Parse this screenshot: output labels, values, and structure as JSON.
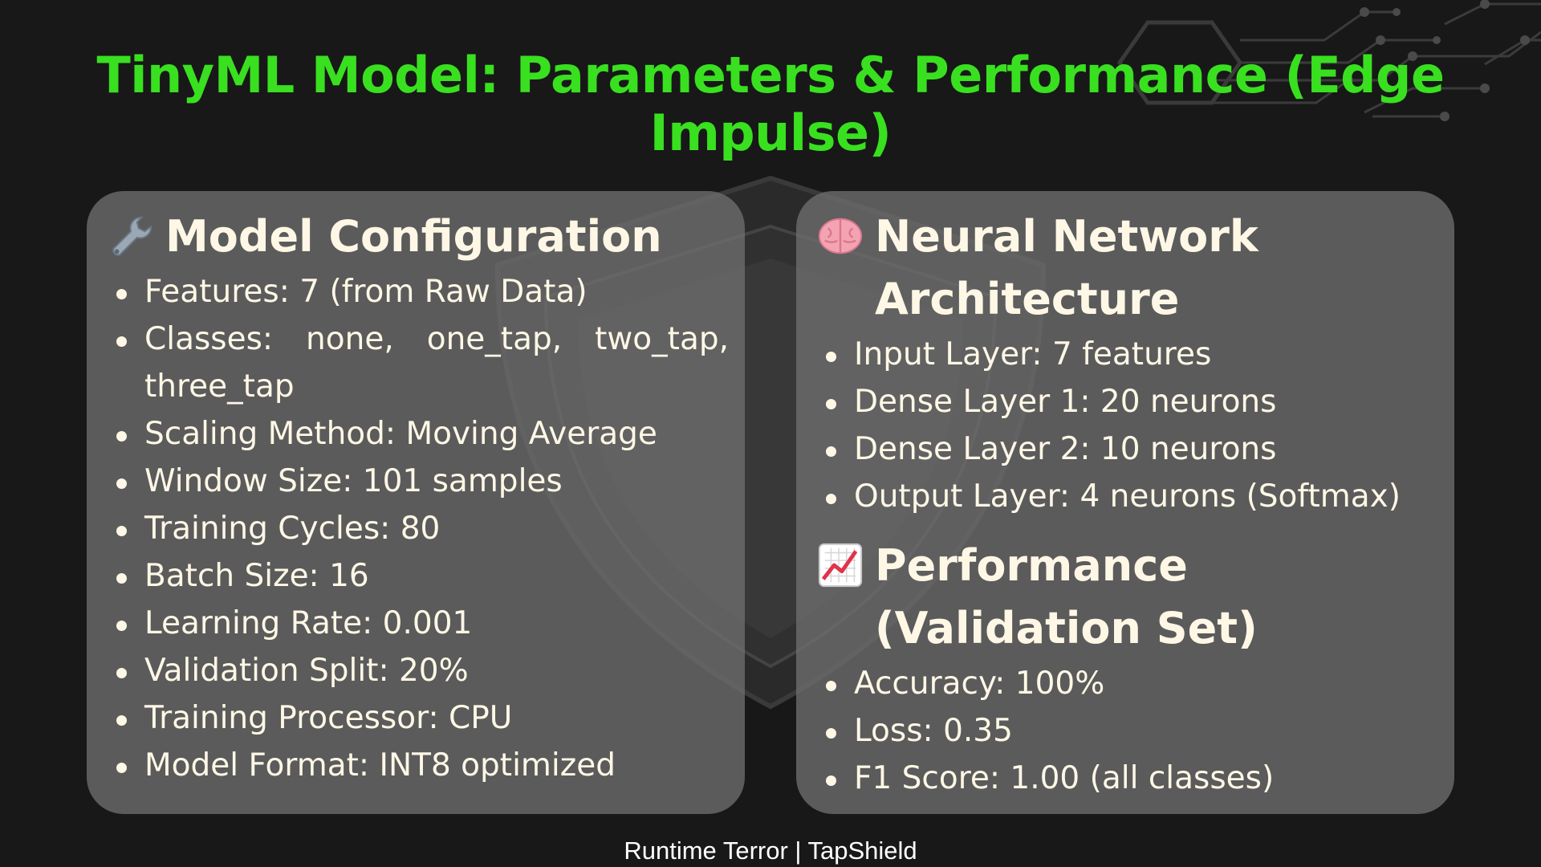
{
  "title": "TinyML Model: Parameters & Performance (Edge Impulse)",
  "model_config": {
    "heading": "Model Configuration",
    "icon": "wrench-icon",
    "items": [
      "Features: 7 (from Raw Data)",
      "Classes: none, one_tap, two_tap, three_tap",
      "Scaling Method: Moving Average",
      "Window Size: 101 samples",
      "Training Cycles: 80",
      "Batch Size: 16",
      "Learning Rate: 0.001",
      "Validation Split: 20%",
      "Training Processor: CPU",
      "Model Format: INT8 optimized"
    ]
  },
  "architecture": {
    "heading": "Neural Network Architecture",
    "icon": "brain-icon",
    "items": [
      "Input Layer: 7 features",
      "Dense Layer 1: 20 neurons",
      "Dense Layer 2: 10 neurons",
      "Output Layer: 4 neurons (Softmax)"
    ]
  },
  "performance": {
    "heading": "Performance (Validation Set)",
    "icon": "chart-increasing-icon",
    "items": [
      "Accuracy: 100%",
      "Loss: 0.35",
      "F1 Score: 1.00 (all classes)"
    ]
  },
  "footer": "Runtime Terror | TapShield",
  "colors": {
    "background": "#181818",
    "title": "#39e01f",
    "card": "#6e6e6e",
    "text": "#fff7e6"
  }
}
